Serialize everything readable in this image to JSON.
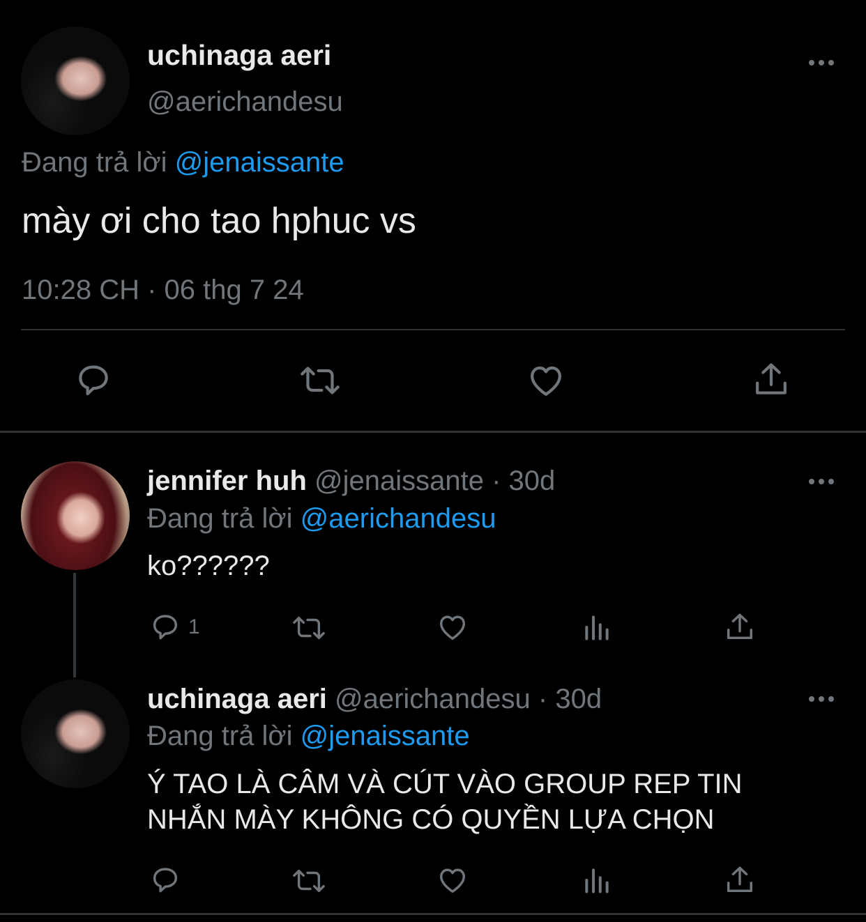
{
  "main_tweet": {
    "display_name": "uchinaga aeri",
    "handle": "@aerichandesu",
    "reply_prefix": "Đang trả lời",
    "reply_to": "@jenaissante",
    "text": "mày ơi cho tao hphuc vs",
    "timestamp": "10:28 CH · 06 thg 7 24"
  },
  "replies": [
    {
      "display_name": "jennifer huh",
      "handle": "@jenaissante",
      "age": "· 30d",
      "reply_prefix": "Đang trả lời",
      "reply_to": "@aerichandesu",
      "text": "ko??????",
      "reply_count": "1"
    },
    {
      "display_name": "uchinaga aeri",
      "handle": "@aerichandesu",
      "age": "· 30d",
      "reply_prefix": "Đang trả lời",
      "reply_to": "@jenaissante",
      "text_line1": "Ý TAO LÀ CÂM VÀ CÚT VÀO GROUP REP TIN",
      "text_line2": "NHẮN MÀY KHÔNG CÓ QUYỀN LỰA CHỌN"
    }
  ],
  "colors": {
    "background": "#000000",
    "text": "#e7e9ea",
    "muted": "#71767b",
    "link": "#1d9bf0",
    "divider": "#2f3336"
  },
  "icons": [
    "more-icon",
    "reply-icon",
    "retweet-icon",
    "like-icon",
    "share-icon",
    "views-icon"
  ]
}
